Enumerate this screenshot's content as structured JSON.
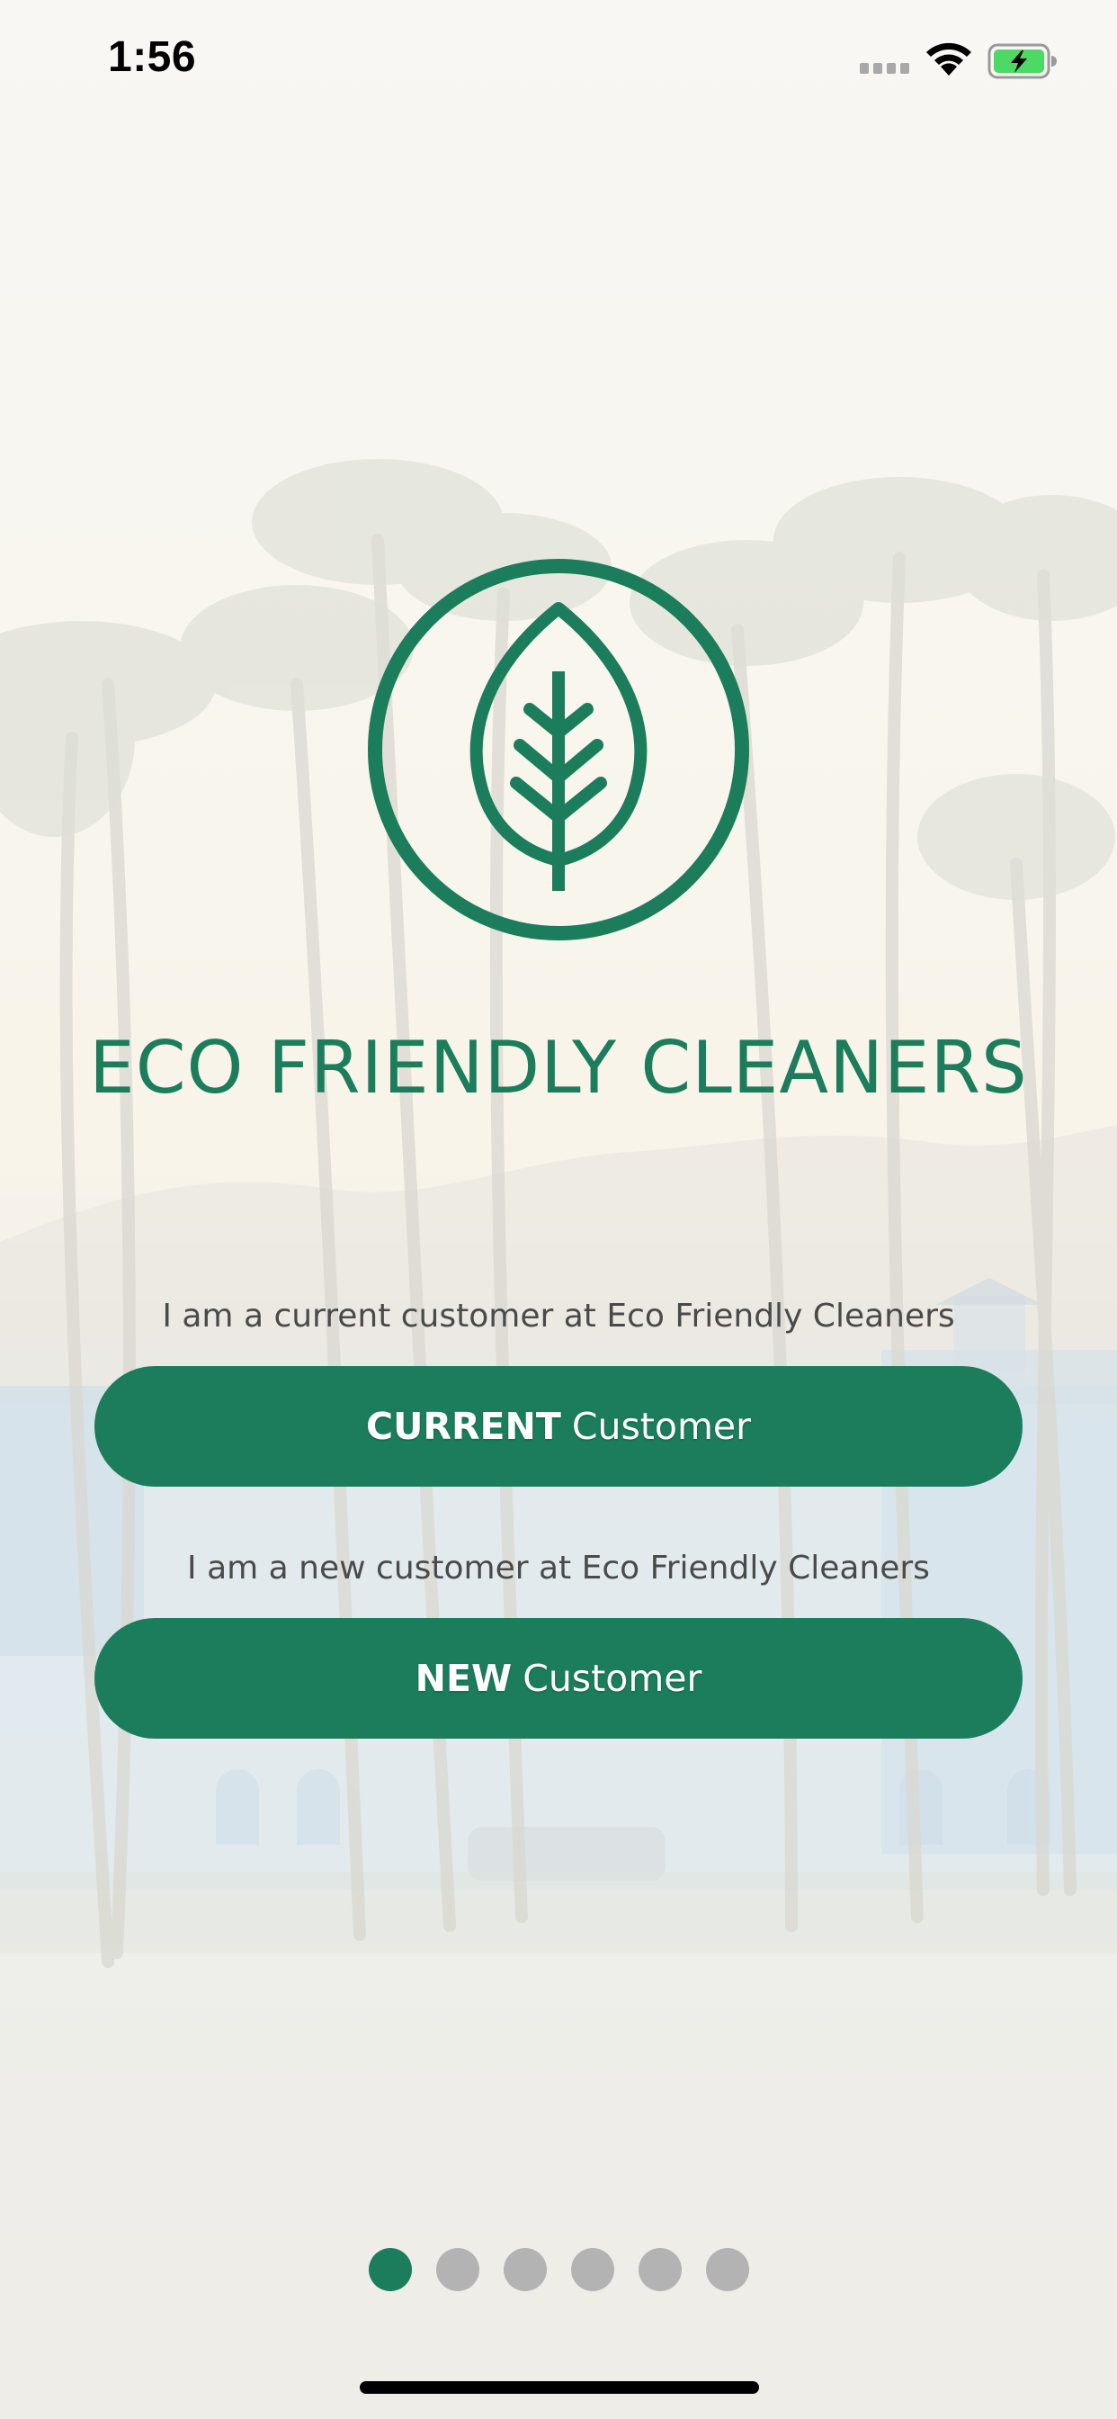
{
  "status_bar": {
    "time": "1:56"
  },
  "icons": {
    "signal": "cellular-signal-icon",
    "wifi": "wifi-icon",
    "battery": "battery-charging-icon",
    "logo": "leaf-in-circle-logo"
  },
  "colors": {
    "brand_green": "#1b7d5c",
    "dot_inactive": "#b3b3b3",
    "caption_text": "#4a4a4a",
    "battery_fill": "#4cd964"
  },
  "brand": {
    "name": "ECO FRIENDLY CLEANERS"
  },
  "current": {
    "caption": "I am a current customer at Eco Friendly Cleaners",
    "button_bold": "CURRENT",
    "button_text": "Customer"
  },
  "new": {
    "caption": "I am a new customer at Eco Friendly Cleaners",
    "button_bold": "NEW",
    "button_text": "Customer"
  },
  "pager": {
    "pages": 6,
    "active_page": 1
  }
}
